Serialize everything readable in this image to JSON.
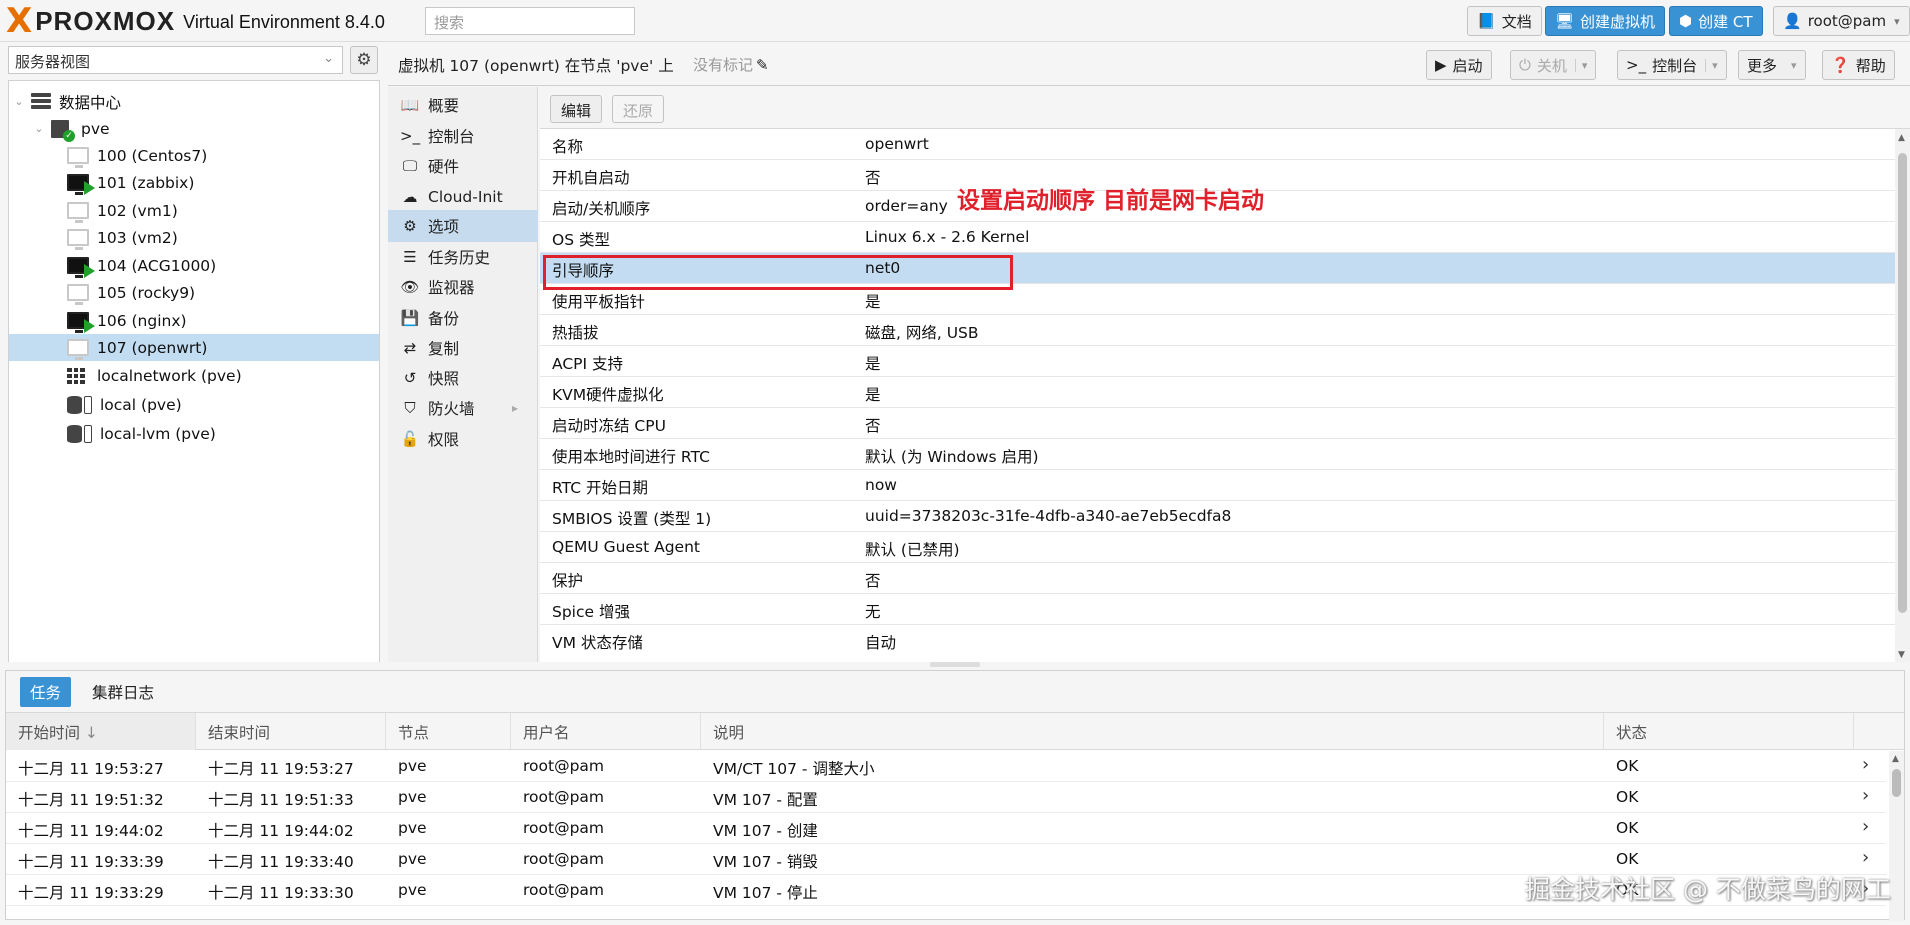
{
  "topbar": {
    "logo_x": "X",
    "logo_text": "PROXMOX",
    "product": "Virtual Environment 8.4.0",
    "search_placeholder": "搜索",
    "buttons": {
      "docs": "文档",
      "create_vm": "创建虚拟机",
      "create_ct": "创建 CT",
      "user": "root@pam"
    }
  },
  "left": {
    "view_select": "服务器视图",
    "tree": [
      {
        "label": "数据中心",
        "icon": "datacenter-icon"
      },
      {
        "label": "pve",
        "icon": "node-icon"
      },
      {
        "label": "100 (Centos7)",
        "icon": "vm-stopped-icon"
      },
      {
        "label": "101 (zabbix)",
        "icon": "vm-running-icon"
      },
      {
        "label": "102 (vm1)",
        "icon": "vm-stopped-icon"
      },
      {
        "label": "103 (vm2)",
        "icon": "vm-stopped-icon"
      },
      {
        "label": "104 (ACG1000)",
        "icon": "vm-running-icon"
      },
      {
        "label": "105 (rocky9)",
        "icon": "vm-stopped-icon"
      },
      {
        "label": "106 (nginx)",
        "icon": "vm-running-icon"
      },
      {
        "label": "107 (openwrt)",
        "icon": "vm-stopped-icon"
      },
      {
        "label": "localnetwork (pve)",
        "icon": "sdn-icon"
      },
      {
        "label": "local (pve)",
        "icon": "storage-icon"
      },
      {
        "label": "local-lvm (pve)",
        "icon": "storage-icon"
      }
    ]
  },
  "main": {
    "title": "虚拟机 107 (openwrt) 在节点 'pve' 上",
    "tags": "没有标记",
    "actions": {
      "start": "启动",
      "shutdown": "关机",
      "console": "控制台",
      "more": "更多",
      "help": "帮助"
    },
    "nav": [
      {
        "label": "概要",
        "icon": "summary-icon"
      },
      {
        "label": "控制台",
        "icon": "console-icon"
      },
      {
        "label": "硬件",
        "icon": "hardware-icon"
      },
      {
        "label": "Cloud-Init",
        "icon": "cloud-icon"
      },
      {
        "label": "选项",
        "icon": "gear-icon"
      },
      {
        "label": "任务历史",
        "icon": "list-icon"
      },
      {
        "label": "监视器",
        "icon": "eye-icon"
      },
      {
        "label": "备份",
        "icon": "floppy-icon"
      },
      {
        "label": "复制",
        "icon": "retweet-icon"
      },
      {
        "label": "快照",
        "icon": "history-icon"
      },
      {
        "label": "防火墙",
        "icon": "shield-icon"
      },
      {
        "label": "权限",
        "icon": "unlock-icon"
      }
    ],
    "toolbar": {
      "edit": "编辑",
      "revert": "还原"
    },
    "options": [
      {
        "key": "名称",
        "value": "openwrt"
      },
      {
        "key": "开机自启动",
        "value": "否"
      },
      {
        "key": "启动/关机顺序",
        "value": "order=any"
      },
      {
        "key": "OS 类型",
        "value": "Linux 6.x - 2.6 Kernel"
      },
      {
        "key": "引导顺序",
        "value": "net0"
      },
      {
        "key": "使用平板指针",
        "value": "是"
      },
      {
        "key": "热插拔",
        "value": "磁盘, 网络, USB"
      },
      {
        "key": "ACPI 支持",
        "value": "是"
      },
      {
        "key": "KVM硬件虚拟化",
        "value": "是"
      },
      {
        "key": "启动时冻结 CPU",
        "value": "否"
      },
      {
        "key": "使用本地时间进行 RTC",
        "value": "默认 (为 Windows 启用)"
      },
      {
        "key": "RTC 开始日期",
        "value": "now"
      },
      {
        "key": "SMBIOS 设置 (类型 1)",
        "value": "uuid=3738203c-31fe-4dfb-a340-ae7eb5ecdfa8"
      },
      {
        "key": "QEMU Guest Agent",
        "value": "默认 (已禁用)"
      },
      {
        "key": "保护",
        "value": "否"
      },
      {
        "key": "Spice 增强",
        "value": "无"
      },
      {
        "key": "VM 状态存储",
        "value": "自动"
      }
    ],
    "annotation": "设置启动顺序 目前是网卡启动"
  },
  "bottom": {
    "tabs": {
      "tasks": "任务",
      "cluster_log": "集群日志"
    },
    "columns": {
      "start": "开始时间",
      "end": "结束时间",
      "node": "节点",
      "user": "用户名",
      "desc": "说明",
      "status": "状态"
    },
    "rows": [
      {
        "start": "十二月 11 19:53:27",
        "end": "十二月 11 19:53:27",
        "node": "pve",
        "user": "root@pam",
        "desc": "VM/CT 107 - 调整大小",
        "status": "OK"
      },
      {
        "start": "十二月 11 19:51:32",
        "end": "十二月 11 19:51:33",
        "node": "pve",
        "user": "root@pam",
        "desc": "VM 107 - 配置",
        "status": "OK"
      },
      {
        "start": "十二月 11 19:44:02",
        "end": "十二月 11 19:44:02",
        "node": "pve",
        "user": "root@pam",
        "desc": "VM 107 - 创建",
        "status": "OK"
      },
      {
        "start": "十二月 11 19:33:39",
        "end": "十二月 11 19:33:40",
        "node": "pve",
        "user": "root@pam",
        "desc": "VM 107 - 销毁",
        "status": "OK"
      },
      {
        "start": "十二月 11 19:33:29",
        "end": "十二月 11 19:33:30",
        "node": "pve",
        "user": "root@pam",
        "desc": "VM 107 - 停止",
        "status": "OK"
      }
    ]
  },
  "watermark": "掘金技术社区 @ 不做菜鸟的网工",
  "colors": {
    "accent": "#3892d4",
    "selected": "#c2ddf2",
    "running": "#21a02b",
    "annotation": "#e0202a",
    "brand": "#e57000"
  }
}
